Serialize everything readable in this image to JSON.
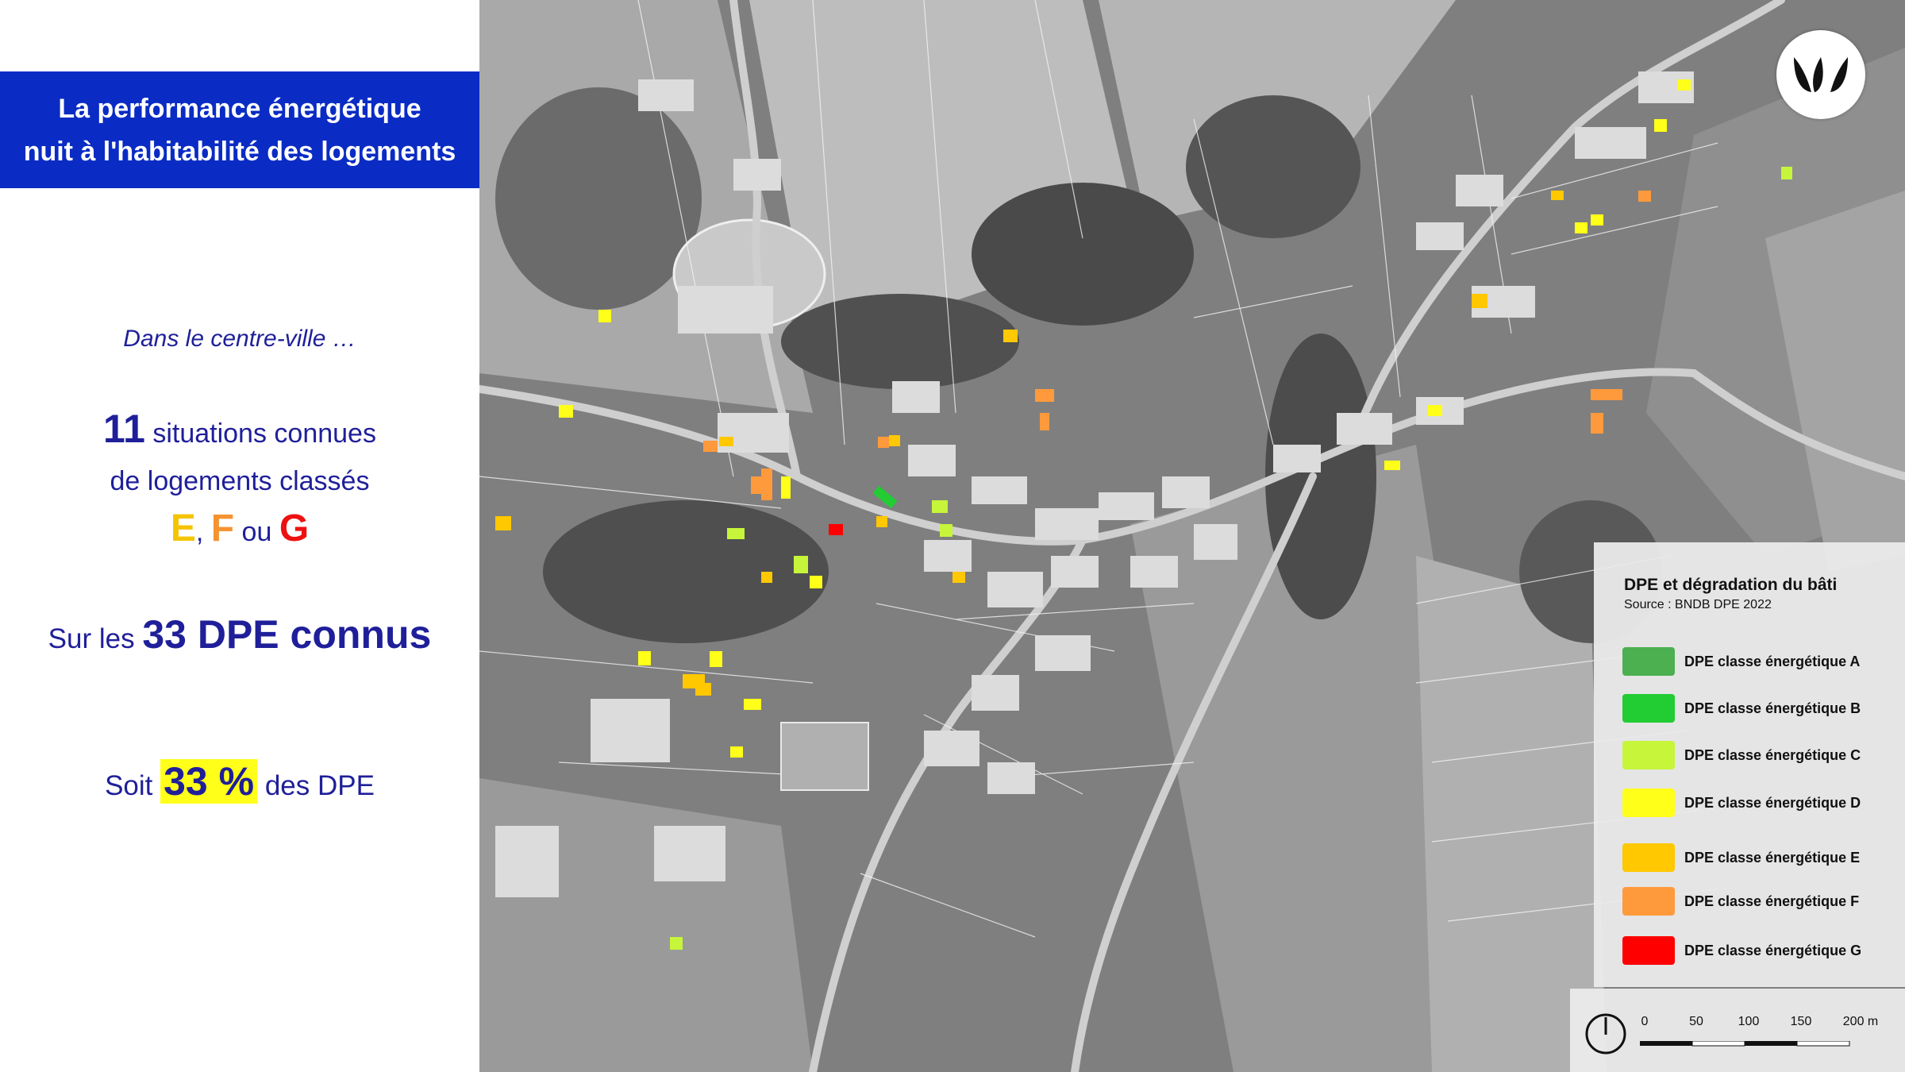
{
  "title": {
    "line1": "La performance énergétique",
    "line2": "nuit à l'habitabilité des logements"
  },
  "intro": "Dans le centre-ville …",
  "stat": {
    "count": "11",
    "text1": "situations connues",
    "text2": "de logements classés",
    "class_e": "E",
    "sep": ",",
    "class_f": "F",
    "ou": "ou",
    "class_g": "G"
  },
  "dpe": {
    "prefix": "Sur les",
    "strong": "33 DPE connus"
  },
  "soit": {
    "prefix": "Soit",
    "percent": "33 %",
    "suffix": "des DPE"
  },
  "legend": {
    "title": "DPE et dégradation du bâti",
    "source": "Source : BNDB DPE 2022",
    "items": [
      {
        "label": "DPE classe énergétique A",
        "color": "#4caf50"
      },
      {
        "label": "DPE classe énergétique B",
        "color": "#22cc33"
      },
      {
        "label": "DPE classe énergétique C",
        "color": "#c6f53a"
      },
      {
        "label": "DPE classe énergétique D",
        "color": "#ffff1a"
      },
      {
        "label": "DPE classe énergétique E",
        "color": "#ffc800"
      },
      {
        "label": "DPE classe énergétique F",
        "color": "#ff9a3c"
      },
      {
        "label": "DPE classe énergétique G",
        "color": "#ff0000"
      }
    ]
  },
  "scale": {
    "ticks": [
      "0",
      "50",
      "100",
      "150",
      "200 m"
    ]
  },
  "colors": {
    "title_bg": "#0a2cc4",
    "text_blue": "#1f1f9a",
    "class_e": "#f5c400",
    "class_f": "#f59331",
    "class_g": "#ee1111",
    "highlight": "#ffff1a"
  }
}
